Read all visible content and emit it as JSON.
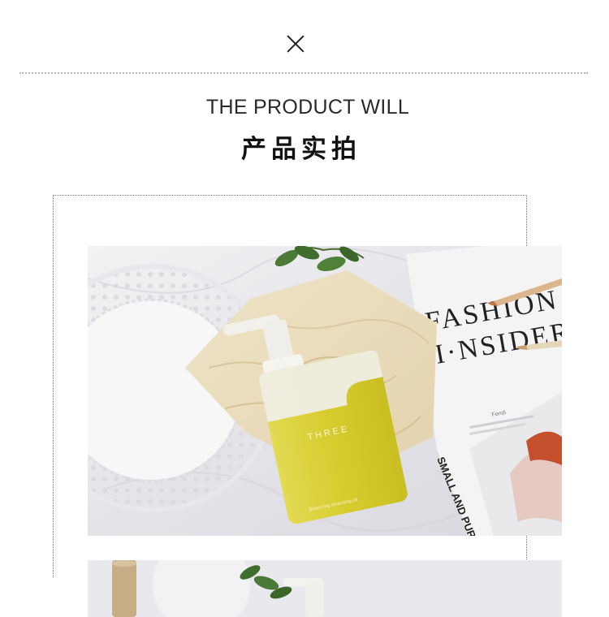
{
  "header": {
    "close_icon": "close-icon",
    "heading_en": "THE PRODUCT WILL",
    "heading_zh": "产品实拍"
  },
  "photo": {
    "magazine_title_line1": "FASHION",
    "magazine_title_line2": "I·NSIDER",
    "magazine_caption": "SMALL AND PURE A",
    "brand_small": "Fendi",
    "bottle_brand": "THREE",
    "bottle_product": "Balancing cleansing oil"
  },
  "colors": {
    "background": "#ffffff",
    "text_dark": "#2a2a2a",
    "bottle_oil": "#d7cf35",
    "wood_board": "#eadcbd"
  }
}
